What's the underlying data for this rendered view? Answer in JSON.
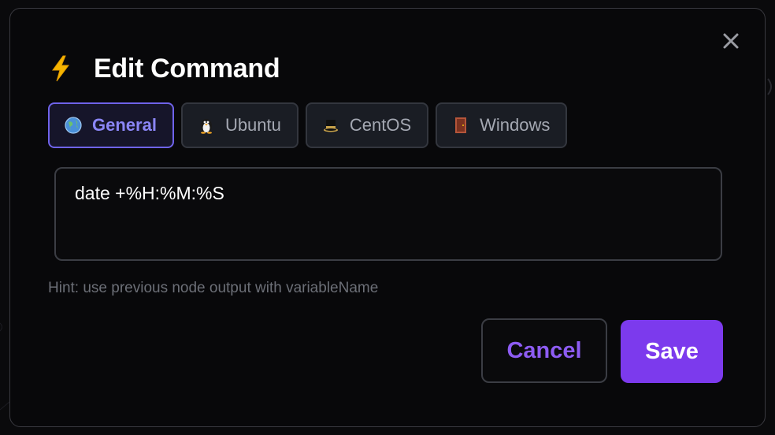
{
  "dialog": {
    "title": "Edit Command",
    "title_icon": "lightning-bolt-icon",
    "close_icon": "close-icon"
  },
  "tabs": [
    {
      "label": "General",
      "icon": "globe-icon",
      "active": true
    },
    {
      "label": "Ubuntu",
      "icon": "penguin-icon",
      "active": false
    },
    {
      "label": "CentOS",
      "icon": "centos-hat-icon",
      "active": false
    },
    {
      "label": "Windows",
      "icon": "windows-door-icon",
      "active": false
    }
  ],
  "command": {
    "value": "date +%H:%M:%S"
  },
  "hint": "Hint: use previous node output with variableName",
  "buttons": {
    "cancel": "Cancel",
    "save": "Save"
  },
  "colors": {
    "accent": "#7c3aed",
    "active_tab_border": "#6f63ea",
    "active_tab_text": "#8b86f6",
    "background": "#08080a"
  }
}
